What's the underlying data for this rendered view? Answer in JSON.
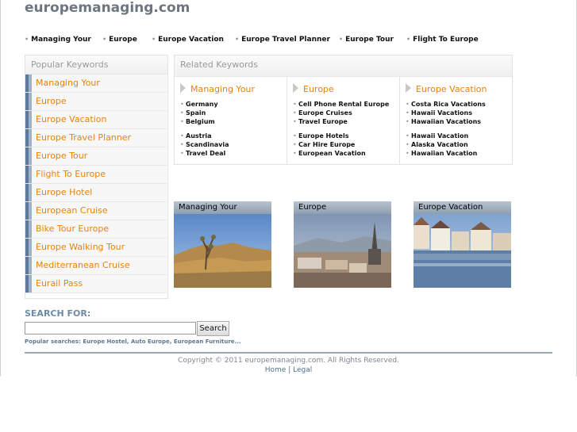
{
  "site": {
    "title": "europemanaging.com"
  },
  "topnav": [
    "Managing Your",
    "Europe",
    "Europe Vacation",
    "Europe Travel Planner",
    "Europe Tour",
    "Flight To Europe"
  ],
  "popular": {
    "heading": "Popular Keywords",
    "items": [
      "Managing Your",
      "Europe",
      "Europe Vacation",
      "Europe Travel Planner",
      "Europe Tour",
      "Flight To Europe",
      "Europe Hotel",
      "European Cruise",
      "Bike Tour Europe",
      "Europe Walking Tour",
      "Mediterranean Cruise",
      "Eurail Pass"
    ]
  },
  "related": {
    "heading": "Related Keywords",
    "columns": [
      {
        "title": "Managing Your",
        "group1": [
          "Germany",
          "Spain",
          "Belgium"
        ],
        "group2": [
          "Austria",
          "Scandinavia",
          "Travel Deal"
        ]
      },
      {
        "title": "Europe",
        "group1": [
          "Cell Phone Rental Europe",
          "Europe Cruises",
          "Travel Europe"
        ],
        "group2": [
          "Europe Hotels",
          "Car Hire Europe",
          "European Vacation"
        ]
      },
      {
        "title": "Europe Vacation",
        "group1": [
          "Costa Rica Vacations",
          "Hawaii Vacations",
          "Hawaiian Vacations"
        ],
        "group2": [
          "Hawaii Vacation",
          "Alaska Vacation",
          "Hawaiian Vacation"
        ]
      }
    ]
  },
  "cards": [
    "Managing Your",
    "Europe",
    "Europe Vacation"
  ],
  "search": {
    "label": "SEARCH FOR:",
    "value": "",
    "button": "Search",
    "popular": "Popular searches: Europe Hostel, Auto Europe, European Furniture..."
  },
  "footer": {
    "copyright": "Copyright © 2011 europemanaging.com. All Rights Reserved.",
    "home": "Home",
    "separator": "|",
    "legal": "Legal"
  },
  "colors": {
    "accent": "#e8820c",
    "title": "#6d7680",
    "link_blue": "#52708e",
    "bar": "#5e7a9a"
  }
}
